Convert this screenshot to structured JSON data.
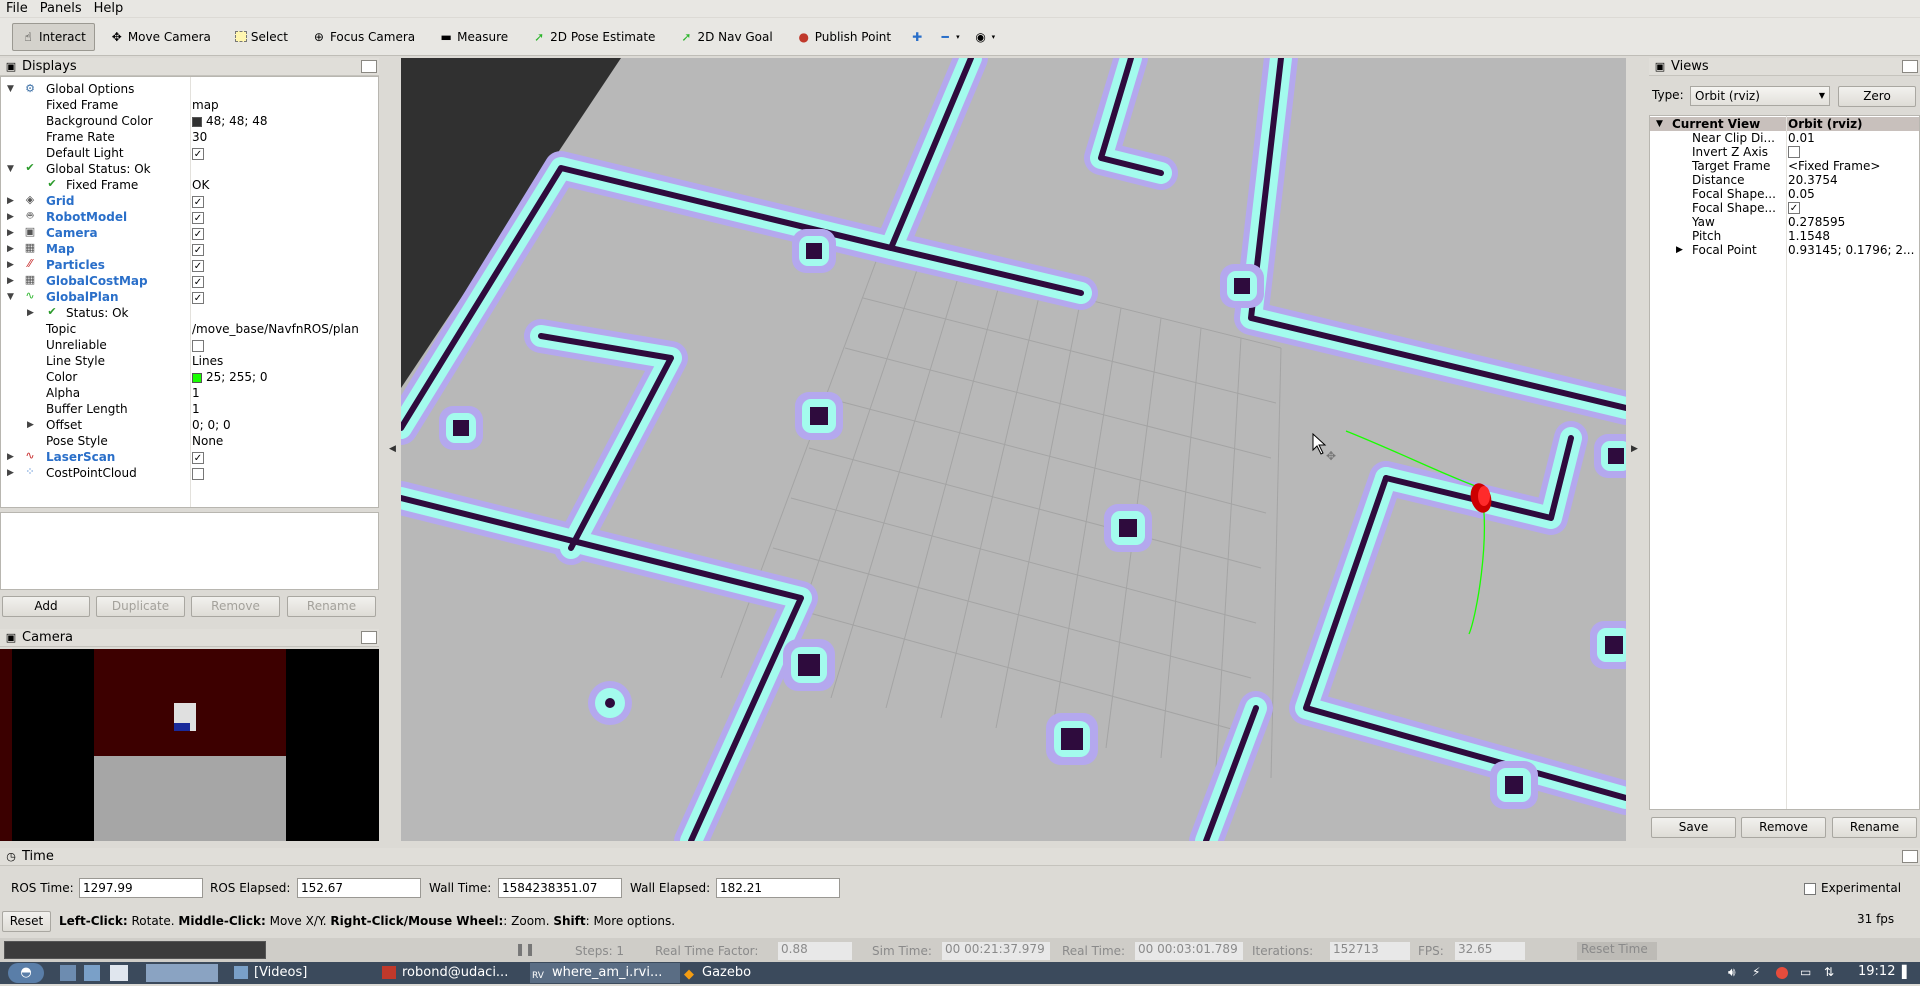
{
  "menubar": {
    "file": "File",
    "panels": "Panels",
    "help": "Help"
  },
  "toolbar": {
    "interact": "Interact",
    "move_camera": "Move Camera",
    "select": "Select",
    "focus_camera": "Focus Camera",
    "measure": "Measure",
    "pose_estimate": "2D Pose Estimate",
    "nav_goal": "2D Nav Goal",
    "publish_point": "Publish Point"
  },
  "displays": {
    "title": "Displays",
    "global_options": "Global Options",
    "fixed_frame_label": "Fixed Frame",
    "fixed_frame_value": "map",
    "bg_color_label": "Background Color",
    "bg_color_value": "48; 48; 48",
    "frame_rate_label": "Frame Rate",
    "frame_rate_value": "30",
    "default_light_label": "Default Light",
    "global_status": "Global Status: Ok",
    "status_fixed_frame": "Fixed Frame",
    "status_fixed_frame_value": "OK",
    "grid": "Grid",
    "robot_model": "RobotModel",
    "camera": "Camera",
    "map": "Map",
    "particles": "Particles",
    "global_cost_map": "GlobalCostMap",
    "global_plan": "GlobalPlan",
    "plan_status": "Status: Ok",
    "topic_label": "Topic",
    "topic_value": "/move_base/NavfnROS/plan",
    "unreliable_label": "Unreliable",
    "line_style_label": "Line Style",
    "line_style_value": "Lines",
    "color_label": "Color",
    "color_value": "25; 255; 0",
    "alpha_label": "Alpha",
    "alpha_value": "1",
    "buffer_label": "Buffer Length",
    "buffer_value": "1",
    "offset_label": "Offset",
    "offset_value": "0; 0; 0",
    "pose_style_label": "Pose Style",
    "pose_style_value": "None",
    "laser_scan": "LaserScan",
    "cost_point_cloud": "CostPointCloud",
    "add": "Add",
    "duplicate": "Duplicate",
    "remove": "Remove",
    "rename": "Rename"
  },
  "camera_panel": {
    "title": "Camera"
  },
  "views": {
    "title": "Views",
    "type_label": "Type:",
    "type_value": "Orbit (rviz)",
    "zero": "Zero",
    "current_view": "Current View",
    "current_view_value": "Orbit (rviz)",
    "near_clip": "Near Clip Di...",
    "near_clip_value": "0.01",
    "invert_z": "Invert Z Axis",
    "target_frame": "Target Frame",
    "target_frame_value": "<Fixed Frame>",
    "distance": "Distance",
    "distance_value": "20.3754",
    "focal_shape1": "Focal Shape...",
    "focal_shape1_value": "0.05",
    "focal_shape2": "Focal Shape...",
    "yaw": "Yaw",
    "yaw_value": "0.278595",
    "pitch": "Pitch",
    "pitch_value": "1.1548",
    "focal_point": "Focal Point",
    "focal_point_value": "0.93145; 0.1796; 2...",
    "save": "Save",
    "remove": "Remove",
    "rename": "Rename"
  },
  "time": {
    "title": "Time",
    "ros_time_label": "ROS Time:",
    "ros_time_value": "1297.99",
    "ros_elapsed_label": "ROS Elapsed:",
    "ros_elapsed_value": "152.67",
    "wall_time_label": "Wall Time:",
    "wall_time_value": "1584238351.07",
    "wall_elapsed_label": "Wall Elapsed:",
    "wall_elapsed_value": "182.21",
    "experimental": "Experimental",
    "reset": "Reset",
    "hint_left": "Left-Click:",
    "hint_left_txt": " Rotate. ",
    "hint_middle": "Middle-Click:",
    "hint_middle_txt": " Move X/Y. ",
    "hint_right": "Right-Click/Mouse Wheel:",
    "hint_right_txt": ": Zoom. ",
    "hint_shift": "Shift",
    "hint_shift_txt": ": More options.",
    "fps": "31 fps"
  },
  "gazebo_strip": {
    "steps": "Steps: 1",
    "rtf": "Real Time Factor:",
    "rtf_value": "0.88",
    "sim_time": "Sim Time:",
    "sim_time_value": "00 00:21:37.979",
    "real_time": "Real Time:",
    "real_time_value": "00 00:03:01.789",
    "iterations": "Iterations:",
    "iterations_value": "152713",
    "fps": "FPS:",
    "fps_value": "32.65",
    "reset_time": "Reset Time"
  },
  "taskbar": {
    "videos": "[Videos]",
    "terminal": "robond@udaci...",
    "rviz": "where_am_i.rvi...",
    "gazebo": "Gazebo",
    "clock": "19:12"
  }
}
